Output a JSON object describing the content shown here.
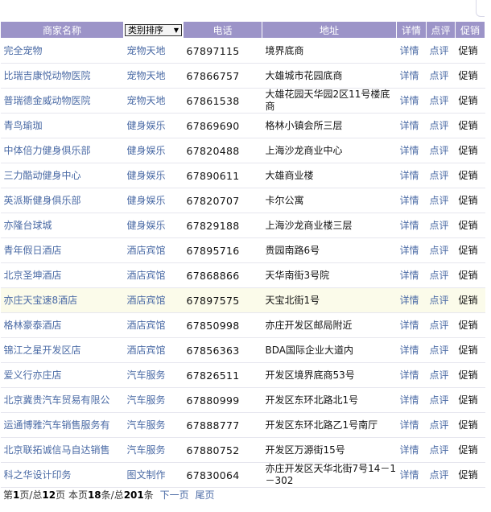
{
  "header": {
    "col_name": "商家名称",
    "col_category": "类别排序",
    "col_phone": "电话",
    "col_address": "地址",
    "col_detail": "详情",
    "col_review": "点评",
    "col_promo": "促销"
  },
  "rows": [
    {
      "name": "完全宠物",
      "category": "宠物天地",
      "phone": "67897115",
      "address": "境界底商",
      "detail": "详情",
      "review": "点评",
      "promo": "促销"
    },
    {
      "name": "比瑞吉康悦动物医院",
      "category": "宠物天地",
      "phone": "67866757",
      "address": "大雄城市花园底商",
      "detail": "详情",
      "review": "点评",
      "promo": "促销"
    },
    {
      "name": "普瑞德金威动物医院",
      "category": "宠物天地",
      "phone": "67861538",
      "address": "大雄花园天华园2区11号楼底商",
      "detail": "详情",
      "review": "点评",
      "promo": "促销"
    },
    {
      "name": "青鸟瑜珈",
      "category": "健身娱乐",
      "phone": "67869690",
      "address": "格林小镇会所三层",
      "detail": "详情",
      "review": "点评",
      "promo": "促销"
    },
    {
      "name": "中体倍力健身俱乐部",
      "category": "健身娱乐",
      "phone": "67820488",
      "address": "上海沙龙商业中心",
      "detail": "详情",
      "review": "点评",
      "promo": "促销"
    },
    {
      "name": "三力酷动健身中心",
      "category": "健身娱乐",
      "phone": "67890611",
      "address": "大雄商业楼",
      "detail": "详情",
      "review": "点评",
      "promo": "促销"
    },
    {
      "name": "英派斯健身俱乐部",
      "category": "健身娱乐",
      "phone": "67820707",
      "address": "卡尔公寓",
      "detail": "详情",
      "review": "点评",
      "promo": "促销"
    },
    {
      "name": "亦隆台球城",
      "category": "健身娱乐",
      "phone": "67829188",
      "address": "上海沙龙商业楼三层",
      "detail": "详情",
      "review": "点评",
      "promo": "促销"
    },
    {
      "name": "青年假日酒店",
      "category": "酒店宾馆",
      "phone": "67895716",
      "address": "贵园南路6号",
      "detail": "详情",
      "review": "点评",
      "promo": "促销"
    },
    {
      "name": "北京圣坤酒店",
      "category": "酒店宾馆",
      "phone": "67868866",
      "address": "天华南街3号院",
      "detail": "详情",
      "review": "点评",
      "promo": "促销"
    },
    {
      "name": "亦庄天宝速8酒店",
      "category": "酒店宾馆",
      "phone": "67897575",
      "address": "天宝北街1号",
      "detail": "详情",
      "review": "点评",
      "promo": "促销"
    },
    {
      "name": "格林豪泰酒店",
      "category": "酒店宾馆",
      "phone": "67850998",
      "address": "亦庄开发区邮局附近",
      "detail": "详情",
      "review": "点评",
      "promo": "促销"
    },
    {
      "name": "锦江之星开发区店",
      "category": "酒店宾馆",
      "phone": "67856363",
      "address": "BDA国际企业大道内",
      "detail": "详情",
      "review": "点评",
      "promo": "促销"
    },
    {
      "name": "爱义行亦庄店",
      "category": "汽车服务",
      "phone": "67826511",
      "address": "开发区境界底商53号",
      "detail": "详情",
      "review": "点评",
      "promo": "促销"
    },
    {
      "name": "北京冀贵汽车贸易有限公",
      "category": "汽车服务",
      "phone": "67880999",
      "address": "开发区东环北路北1号",
      "detail": "详情",
      "review": "点评",
      "promo": "促销"
    },
    {
      "name": "运通博雅汽车销售服务有",
      "category": "汽车服务",
      "phone": "67888777",
      "address": "开发区东环北路乙1号南厅",
      "detail": "详情",
      "review": "点评",
      "promo": "促销"
    },
    {
      "name": "北京联拓诚信马自达销售",
      "category": "汽车服务",
      "phone": "67880752",
      "address": "开发区万源街15号",
      "detail": "详情",
      "review": "点评",
      "promo": "促销"
    },
    {
      "name": "科之华设计印务",
      "category": "图文制作",
      "phone": "67830064",
      "address": "亦庄开发区天华北街7号14－1－302",
      "detail": "详情",
      "review": "点评",
      "promo": "促销"
    }
  ],
  "pager": {
    "t1": "第",
    "current": "1",
    "t2": "页/总",
    "total_pages": "12",
    "t3": "页 本页",
    "page_count": "18",
    "t4": "条/总",
    "total_items": "201",
    "t5": "条",
    "next_label": "下一页",
    "last_label": "尾页"
  },
  "colors": {
    "header_bg": "#9c94c8",
    "link": "#4a6aa5",
    "highlight_row": "#fbfbea"
  }
}
